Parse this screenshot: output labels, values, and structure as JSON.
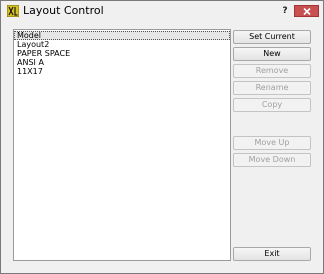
{
  "window": {
    "title": "Layout Control",
    "help_label": "?"
  },
  "layouts": {
    "items": [
      {
        "label": "Model",
        "selected": true
      },
      {
        "label": "Layout2",
        "selected": false
      },
      {
        "label": "PAPER SPACE",
        "selected": false
      },
      {
        "label": "ANSI A",
        "selected": false
      },
      {
        "label": "11X17",
        "selected": false
      }
    ]
  },
  "buttons": {
    "set_current": "Set Current",
    "new": "New",
    "remove": "Remove",
    "rename": "Rename",
    "copy": "Copy",
    "move_up": "Move Up",
    "move_down": "Move Down",
    "exit": "Exit"
  },
  "colors": {
    "close_button": "#c75050",
    "app_icon": "#d8c020",
    "disabled_text": "#a0a0a0"
  }
}
